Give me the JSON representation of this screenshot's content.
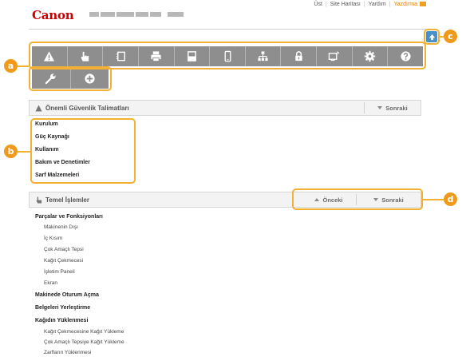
{
  "header": {
    "logo": "Canon",
    "top_links": [
      "Üst",
      "Site Haritası",
      "Yardım",
      "Yazdırma"
    ]
  },
  "icon_bar": {
    "row1": [
      "warning-icon",
      "hand-icon",
      "paper-icon",
      "printer-icon",
      "scanner-glass-icon",
      "phone-icon",
      "network-icon",
      "lock-icon",
      "remote-ui-icon",
      "gear-icon",
      "help-icon"
    ],
    "row2": [
      "wrench-icon",
      "plus-circle-icon"
    ]
  },
  "callouts": {
    "a": "a",
    "b": "b",
    "c": "c",
    "d": "d"
  },
  "safety_section": {
    "title": "Önemli Güvenlik Talimatları",
    "next": "Sonraki",
    "items": [
      "Kurulum",
      "Güç Kaynağı",
      "Kullanım",
      "Bakım ve Denetimler",
      "Sarf Malzemeleri"
    ]
  },
  "basic_section": {
    "title": "Temel İşlemler",
    "prev": "Önceki",
    "next": "Sonraki",
    "groups": [
      {
        "title": "Parçalar ve Fonksiyonları",
        "items": [
          "Makinenin Dışı",
          "İç Kısım",
          "Çok Amaçlı Tepsi",
          "Kağıt Çekmecesi",
          "İşletim Paneli",
          "Ekran"
        ]
      },
      {
        "title": "Makinede Oturum Açma",
        "items": []
      },
      {
        "title": "Belgeleri Yerleştirme",
        "items": []
      },
      {
        "title": "Kağıdın Yüklenmesi",
        "items": [
          "Kağıt Çekmecesine Kağıt Yükleme",
          "Çok Amaçlı Tepsiye Kağıt Yükleme",
          "Zarfların Yüklenmesi"
        ]
      }
    ]
  },
  "colors": {
    "accent": "#ef9a1a",
    "icon_bar": "#8e8e8e",
    "logo": "#cc0000",
    "print_link": "#e07a00",
    "top_button": "#4a90c8"
  }
}
